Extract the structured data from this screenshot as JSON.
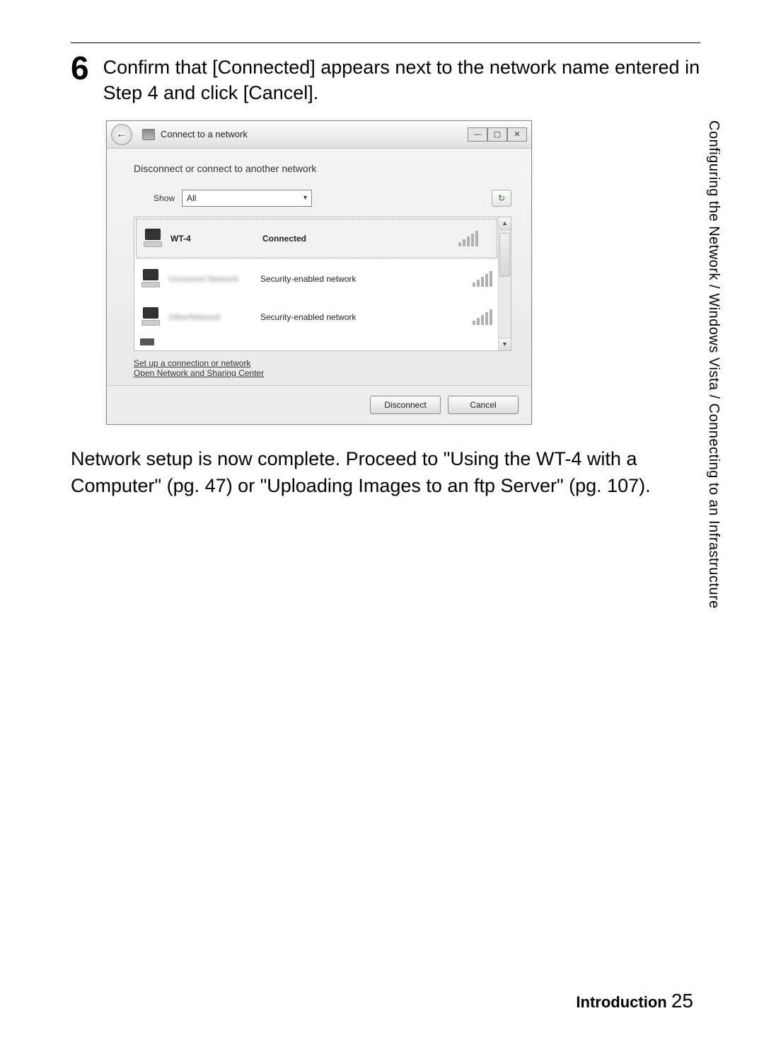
{
  "step": {
    "number": "6",
    "text": "Confirm that [Connected] appears next to the network name entered in Step 4 and click [Cancel]."
  },
  "dialog": {
    "title": "Connect to a network",
    "heading": "Disconnect or connect to another network",
    "show_label": "Show",
    "show_value": "All",
    "networks": [
      {
        "name": "WT-4",
        "status": "Connected",
        "bold": true
      },
      {
        "name": "Unnamed Network",
        "status": "Security-enabled network",
        "blur": true
      },
      {
        "name": "OtherNetwork",
        "status": "Security-enabled network",
        "blur": true
      }
    ],
    "link_setup": "Set up a connection or network",
    "link_center": "Open Network and Sharing Center",
    "btn_disconnect": "Disconnect",
    "btn_cancel": "Cancel"
  },
  "paragraph": "Network setup is now complete.  Proceed to \"Using the WT-4 with a Computer\" (pg. 47) or \"Uploading Images to an ftp Server\" (pg. 107).",
  "side_text": "Configuring the Network / Windows Vista / Connecting to an Infrastructure",
  "footer": {
    "label": "Introduction",
    "page": "25"
  }
}
